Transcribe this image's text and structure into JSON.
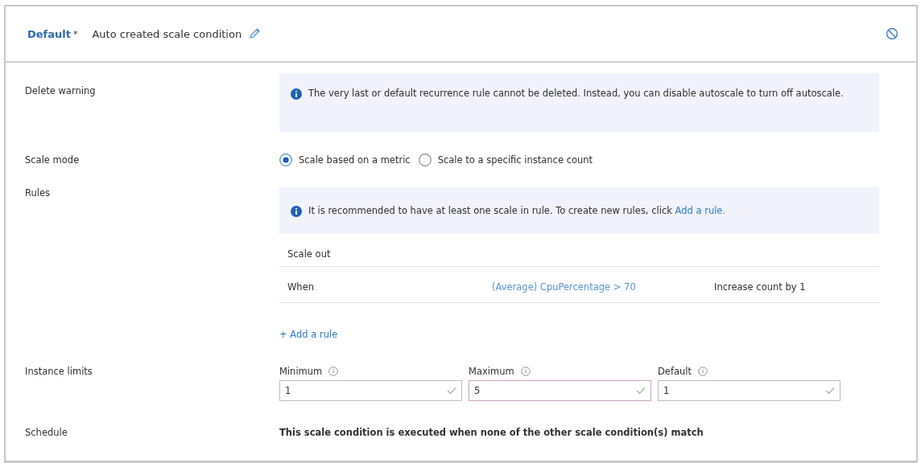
{
  "header": {
    "title": "Default",
    "required_mark": "*",
    "name": "Auto created scale condition"
  },
  "delete_warning": {
    "label": "Delete warning",
    "message": "The very last or default recurrence rule cannot be deleted. Instead, you can disable autoscale to turn off autoscale."
  },
  "scale_mode": {
    "label": "Scale mode",
    "options": [
      {
        "label": "Scale based on a metric",
        "selected": true
      },
      {
        "label": "Scale to a specific instance count",
        "selected": false
      }
    ]
  },
  "rules": {
    "label": "Rules",
    "message": "It is recommended to have at least one scale in rule. To create new rules, click",
    "link": "Add a rule.",
    "heading": "Scale out",
    "rows": [
      {
        "column_1": "When",
        "condition": "(Average) CpuPercentage > 70",
        "action": "Increase count by 1"
      }
    ],
    "add_rule": "+ Add a rule"
  },
  "instance_limits": {
    "label": "Instance limits",
    "fields": [
      {
        "label": "Minimum",
        "value": "1",
        "valid": true,
        "focused": false
      },
      {
        "label": "Maximum",
        "value": "5",
        "valid": true,
        "focused": true
      },
      {
        "label": "Default",
        "value": "1",
        "valid": true,
        "focused": false
      }
    ]
  },
  "schedule": {
    "label": "Schedule",
    "message": "This scale condition is executed when none of the other scale condition(s) match"
  }
}
